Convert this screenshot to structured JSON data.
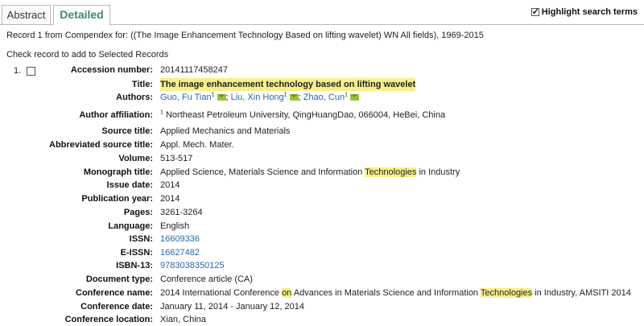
{
  "tabs": [
    {
      "label": "Abstract",
      "active": false
    },
    {
      "label": "Detailed",
      "active": true
    }
  ],
  "highlight_toggle": {
    "label": "Highlight search terms",
    "checked": true
  },
  "record_summary": "Record 1 from Compendex for: ((The Image Enhancement Technology Based on lifting wavelet) WN All fields), 1969-2015",
  "check_instructions": "Check record to add to Selected Records",
  "record": {
    "number": "1.",
    "fields": {
      "accession_number": {
        "label": "Accession number:",
        "value": "20141117458247"
      },
      "title": {
        "label": "Title:",
        "value": "The image enhancement technology based on lifting wavelet"
      },
      "authors": {
        "label": "Authors:",
        "list": [
          {
            "name": "Guo, Fu Tian",
            "sup": "1",
            "sep": ";"
          },
          {
            "name": "Liu, Xin Hong",
            "sup": "1",
            "sep": ";"
          },
          {
            "name": "Zhao, Cun",
            "sup": "1",
            "sep": ""
          }
        ]
      },
      "author_affiliation": {
        "label": "Author affiliation:",
        "sup": "1",
        "value": "Northeast Petroleum University, QingHuangDao, 066004, HeBei, China"
      },
      "source_title": {
        "label": "Source title:",
        "value": "Applied Mechanics and Materials"
      },
      "abbreviated_source_title": {
        "label": "Abbreviated source title:",
        "value": "Appl. Mech. Mater."
      },
      "volume": {
        "label": "Volume:",
        "value": "513-517"
      },
      "monograph_title": {
        "label": "Monograph title:",
        "pre": "Applied Science, Materials Science and Information ",
        "highlight": "Technologies",
        "post": " in Industry"
      },
      "issue_date": {
        "label": "Issue date:",
        "value": "2014"
      },
      "publication_year": {
        "label": "Publication year:",
        "value": "2014"
      },
      "pages": {
        "label": "Pages:",
        "value": "3261-3264"
      },
      "language": {
        "label": "Language:",
        "value": "English"
      },
      "issn": {
        "label": "ISSN:",
        "value": "16609336"
      },
      "eissn": {
        "label": "E-ISSN:",
        "value": "16627482"
      },
      "isbn13": {
        "label": "ISBN-13:",
        "value": "9783038350125"
      },
      "document_type": {
        "label": "Document type:",
        "value": "Conference article (CA)"
      },
      "conference_name": {
        "label": "Conference name:",
        "p1": "2014 International Conference ",
        "h1": "on",
        "p2": " Advances in Materials Science and Information ",
        "h2": "Technologies",
        "p3": " in Industry, AMSITI 2014"
      },
      "conference_date": {
        "label": "Conference date:",
        "value": "January 11, 2014 - January 12, 2014"
      },
      "conference_location": {
        "label": "Conference location:",
        "value": "Xian, China"
      }
    }
  },
  "colors": {
    "highlight": "#f7f08a",
    "link": "#2a66ae",
    "active_tab": "#3a8a6c",
    "mail_icon": "#9ac43a"
  }
}
